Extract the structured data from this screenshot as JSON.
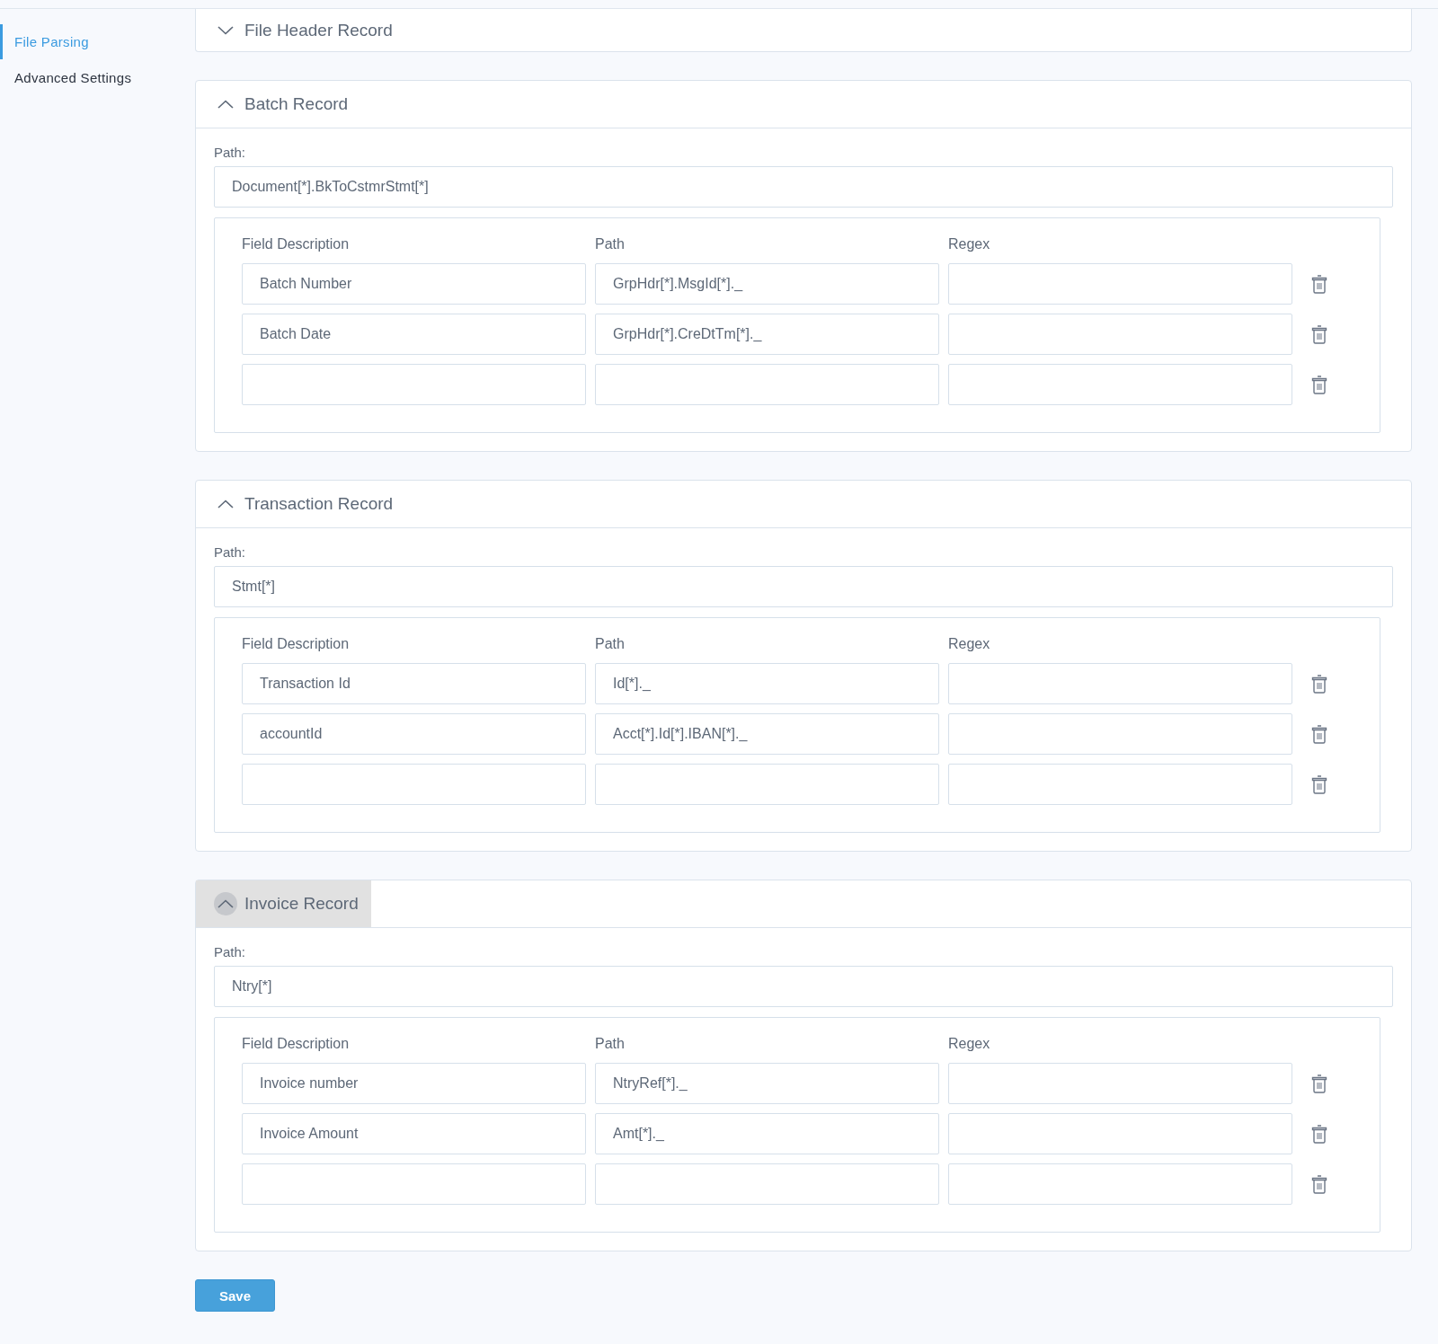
{
  "sidebar": {
    "items": [
      {
        "label": "File Parsing",
        "selected": true
      },
      {
        "label": "Advanced Settings",
        "selected": false
      }
    ]
  },
  "sections": [
    {
      "title": "File Header Record",
      "expanded": false,
      "highlighted": false
    },
    {
      "title": "Batch Record",
      "expanded": true,
      "highlighted": false,
      "path_label": "Path:",
      "path": "Document[*].BkToCstmrStmt[*]",
      "columns": [
        "Field Description",
        "Path",
        "Regex"
      ],
      "rows": [
        {
          "description": "Batch Number",
          "path": "GrpHdr[*].MsgId[*]._",
          "regex": ""
        },
        {
          "description": "Batch Date",
          "path": "GrpHdr[*].CreDtTm[*]._",
          "regex": ""
        },
        {
          "description": "",
          "path": "",
          "regex": ""
        }
      ]
    },
    {
      "title": "Transaction Record",
      "expanded": true,
      "highlighted": false,
      "path_label": "Path:",
      "path": "Stmt[*]",
      "columns": [
        "Field Description",
        "Path",
        "Regex"
      ],
      "rows": [
        {
          "description": "Transaction Id",
          "path": "Id[*]._",
          "regex": ""
        },
        {
          "description": "accountId",
          "path": "Acct[*].Id[*].IBAN[*]._",
          "regex": ""
        },
        {
          "description": "",
          "path": "",
          "regex": ""
        }
      ]
    },
    {
      "title": "Invoice Record",
      "expanded": true,
      "highlighted": true,
      "path_label": "Path:",
      "path": "Ntry[*]",
      "columns": [
        "Field Description",
        "Path",
        "Regex"
      ],
      "rows": [
        {
          "description": "Invoice number",
          "path": "NtryRef[*]._",
          "regex": ""
        },
        {
          "description": "Invoice Amount",
          "path": "Amt[*]._",
          "regex": ""
        },
        {
          "description": "",
          "path": "",
          "regex": ""
        }
      ]
    }
  ],
  "save_button": "Save"
}
